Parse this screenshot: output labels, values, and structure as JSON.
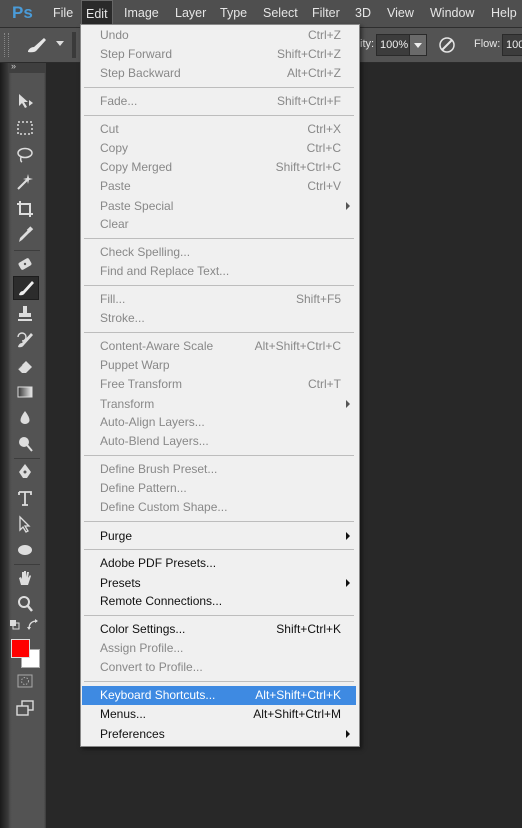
{
  "app": {
    "logo": "Ps"
  },
  "menubar": [
    {
      "label": "File"
    },
    {
      "label": "Edit"
    },
    {
      "label": "Image"
    },
    {
      "label": "Layer"
    },
    {
      "label": "Type"
    },
    {
      "label": "Select"
    },
    {
      "label": "Filter"
    },
    {
      "label": "3D"
    },
    {
      "label": "View"
    },
    {
      "label": "Window"
    },
    {
      "label": "Help"
    }
  ],
  "options": {
    "opacity_label": "ity:",
    "opacity_value": "100%",
    "flow_label": "Flow:",
    "flow_value": "100"
  },
  "tools_panel": {
    "collapse": "»"
  },
  "colors": {
    "foreground": "#ff0000",
    "background": "#ffffff",
    "highlight": "#3e8ae2"
  },
  "edit_menu": {
    "undo": {
      "label": "Undo",
      "shortcut": "Ctrl+Z"
    },
    "step_forward": {
      "label": "Step Forward",
      "shortcut": "Shift+Ctrl+Z"
    },
    "step_backward": {
      "label": "Step Backward",
      "shortcut": "Alt+Ctrl+Z"
    },
    "fade": {
      "label": "Fade...",
      "shortcut": "Shift+Ctrl+F"
    },
    "cut": {
      "label": "Cut",
      "shortcut": "Ctrl+X"
    },
    "copy": {
      "label": "Copy",
      "shortcut": "Ctrl+C"
    },
    "copy_merged": {
      "label": "Copy Merged",
      "shortcut": "Shift+Ctrl+C"
    },
    "paste": {
      "label": "Paste",
      "shortcut": "Ctrl+V"
    },
    "paste_special": {
      "label": "Paste Special"
    },
    "clear": {
      "label": "Clear"
    },
    "check_spelling": {
      "label": "Check Spelling..."
    },
    "find_replace": {
      "label": "Find and Replace Text..."
    },
    "fill": {
      "label": "Fill...",
      "shortcut": "Shift+F5"
    },
    "stroke": {
      "label": "Stroke..."
    },
    "content_aware_scale": {
      "label": "Content-Aware Scale",
      "shortcut": "Alt+Shift+Ctrl+C"
    },
    "puppet_warp": {
      "label": "Puppet Warp"
    },
    "free_transform": {
      "label": "Free Transform",
      "shortcut": "Ctrl+T"
    },
    "transform": {
      "label": "Transform"
    },
    "auto_align": {
      "label": "Auto-Align Layers..."
    },
    "auto_blend": {
      "label": "Auto-Blend Layers..."
    },
    "define_brush": {
      "label": "Define Brush Preset..."
    },
    "define_pattern": {
      "label": "Define Pattern..."
    },
    "define_shape": {
      "label": "Define Custom Shape..."
    },
    "purge": {
      "label": "Purge"
    },
    "pdf_presets": {
      "label": "Adobe PDF Presets..."
    },
    "presets": {
      "label": "Presets"
    },
    "remote_connections": {
      "label": "Remote Connections..."
    },
    "color_settings": {
      "label": "Color Settings...",
      "shortcut": "Shift+Ctrl+K"
    },
    "assign_profile": {
      "label": "Assign Profile..."
    },
    "convert_profile": {
      "label": "Convert to Profile..."
    },
    "keyboard_shortcuts": {
      "label": "Keyboard Shortcuts...",
      "shortcut": "Alt+Shift+Ctrl+K"
    },
    "menus": {
      "label": "Menus...",
      "shortcut": "Alt+Shift+Ctrl+M"
    },
    "preferences": {
      "label": "Preferences"
    }
  }
}
